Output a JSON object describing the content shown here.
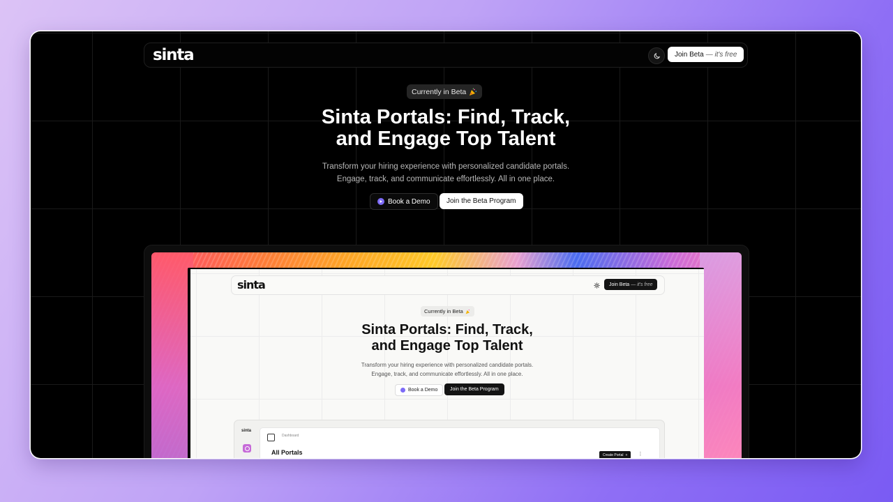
{
  "nav": {
    "logo": "sinta",
    "theme_icon": "moon-icon",
    "join_label": "Join Beta",
    "join_suffix": "— it's free"
  },
  "hero": {
    "badge": "Currently in Beta",
    "badge_icon": "party-popper-icon",
    "title_line1": "Sinta Portals: Find, Track,",
    "title_line2": "and Engage Top Talent",
    "subtitle_line1": "Transform your hiring experience with personalized candidate portals.",
    "subtitle_line2": "Engage, track, and communicate effortlessly. All in one place.",
    "demo_label": "Book a Demo",
    "beta_label": "Join the Beta Program"
  },
  "preview": {
    "nav": {
      "logo": "sinta",
      "theme_icon": "sun-icon",
      "join_label": "Join Beta",
      "join_suffix": "— it's free"
    },
    "badge": "Currently in Beta",
    "title_line1": "Sinta Portals: Find, Track,",
    "title_line2": "and Engage Top Talent",
    "subtitle_line1": "Transform your hiring experience with personalized candidate portals.",
    "subtitle_line2": "Engage, track, and communicate effortlessly. All in one place.",
    "demo_label": "Book a Demo",
    "beta_label": "Join the Beta Program",
    "dashboard": {
      "sidebar_logo": "sinta",
      "breadcrumb": "Dashboard",
      "heading": "All Portals",
      "create_label": "Create Portal",
      "create_icon": "+",
      "more_icon": "⋮"
    }
  },
  "colors": {
    "accent": "#7d6bf7",
    "background_gradient_start": "#dcc3f6",
    "background_gradient_end": "#7a5bf3"
  }
}
